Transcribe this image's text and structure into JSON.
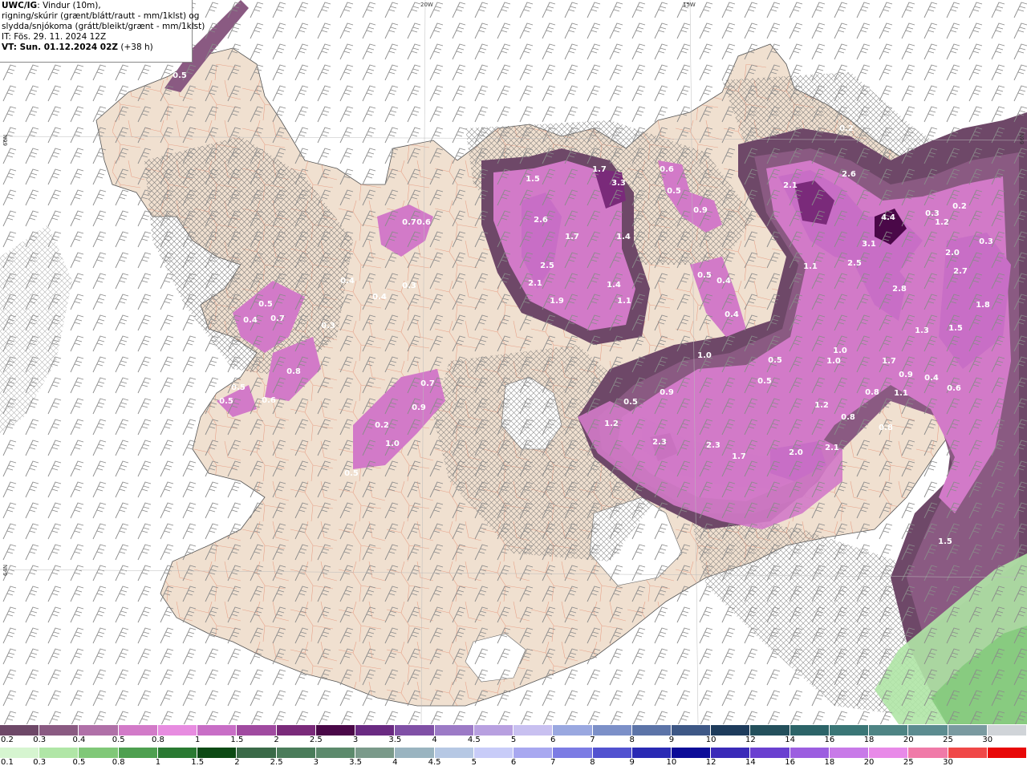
{
  "header": {
    "product": "UWC/IG",
    "desc1": ": Vindur (10m),",
    "desc2": "rigning/skúrir (grænt/blátt/rautt - mm/1klst) og",
    "desc3": "slydda/snjókoma (grátt/bleikt/grænt - mm/1klst)",
    "it": "IT: Fös. 29. 11. 2024 12Z",
    "vt": "VT: Sun. 01.12.2024 02Z",
    "lead": "(+38 h)"
  },
  "graticule": {
    "top": [
      "20W",
      "15W"
    ],
    "left": [
      "66N",
      "64N"
    ],
    "right": [
      "66N"
    ]
  },
  "map_values": [
    "0.5",
    "0.7",
    "0.6",
    "0.4",
    "0.3",
    "0.4",
    "0.5",
    "0.4",
    "0.7",
    "0.3",
    "0.8",
    "0.5",
    "0.5",
    "0.6",
    "0.7",
    "0.9",
    "0.2",
    "1.0",
    "0.5",
    "1.5",
    "2.6",
    "1.7",
    "2.5",
    "2.1",
    "1.9",
    "1.7",
    "3.3",
    "1.4",
    "1.4",
    "1.1",
    "0.6",
    "0.5",
    "0.9",
    "0.5",
    "0.4",
    "0.4",
    "0.4",
    "2.1",
    "2.6",
    "0.2",
    "4.4",
    "3.1",
    "2.5",
    "1.1",
    "2.8",
    "0.3",
    "1.2",
    "0.2",
    "0.3",
    "2.0",
    "2.7",
    "1.8",
    "1.5",
    "1.0",
    "1.0",
    "1.7",
    "0.9",
    "1.3",
    "0.4",
    "0.6",
    "0.5",
    "0.5",
    "1.1",
    "1.2",
    "0.8",
    "0.8",
    "0.8",
    "1.0",
    "0.5",
    "0.9",
    "1.2",
    "2.3",
    "2.3",
    "1.7",
    "2.0",
    "2.1",
    "1.5"
  ],
  "legend": {
    "snow_ticks": [
      "0.2",
      "0.3",
      "0.4",
      "0.5",
      "0.8",
      "1",
      "1.5",
      "2",
      "2.5",
      "3",
      "3.5",
      "4",
      "4.5",
      "5",
      "6",
      "7",
      "8",
      "9",
      "10",
      "12",
      "14",
      "16",
      "18",
      "20",
      "25",
      "30"
    ],
    "snow_colors": [
      "#6e4868",
      "#8a5a82",
      "#b070a8",
      "#d27ac8",
      "#e78ce0",
      "#c86ec6",
      "#a04aa0",
      "#7a2a7a",
      "#4a0848",
      "#6a2a82",
      "#8050a6",
      "#9c7ac6",
      "#b8a0e0",
      "#c8c0f0",
      "#9aa8e0",
      "#7c90c8",
      "#5c74a8",
      "#3e5886",
      "#1e3c5c",
      "#24505c",
      "#2c6468",
      "#3a7676",
      "#4e8484",
      "#5c8c90",
      "#7a9aa0",
      "#d0d4d8"
    ],
    "rain_ticks": [
      "0.1",
      "0.3",
      "0.5",
      "0.8",
      "1",
      "1.5",
      "2",
      "2.5",
      "3",
      "3.5",
      "4",
      "4.5",
      "5",
      "6",
      "7",
      "8",
      "9",
      "10",
      "12",
      "14",
      "16",
      "18",
      "20",
      "25",
      "30"
    ],
    "rain_colors": [
      "#d6f5d0",
      "#b0e6a6",
      "#80c878",
      "#4ea050",
      "#2a7a32",
      "#0c4a14",
      "#3a6a48",
      "#4a7c5a",
      "#5c8a6c",
      "#7a9a8a",
      "#9ab4c0",
      "#b6c8e4",
      "#c8ccf8",
      "#a8a8f0",
      "#7c7ce4",
      "#5252d0",
      "#2a2ab4",
      "#0c0c98",
      "#3a2ab8",
      "#6a40d0",
      "#9c5ee0",
      "#c87ae8",
      "#e88ae8",
      "#f07aa8",
      "#f04848",
      "#e80808"
    ]
  }
}
